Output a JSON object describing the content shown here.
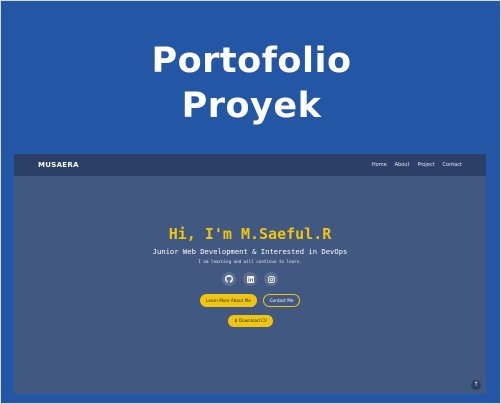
{
  "card": {
    "title_line1": "Portofolio",
    "title_line2": "Proyek"
  },
  "site": {
    "brand": "MUSAERA",
    "nav": [
      "Home",
      "About",
      "Project",
      "Contact"
    ],
    "hero": {
      "title": "Hi, I'm M.Saeful.R",
      "subtitle": "Junior Web Development & Interested in DevOps",
      "note": "I am learning and will continue to learn."
    },
    "socials": [
      "github-icon",
      "linkedin-icon",
      "instagram-icon"
    ],
    "buttons": {
      "learn_more": "Learn More About Me",
      "contact": "Contact Me",
      "download_cv": "Download CV"
    },
    "back_to_top_icon": "arrow-up-icon"
  },
  "colors": {
    "outer_bg": "#2456a6",
    "site_bg": "#415880",
    "navbar_bg": "#2c3f66",
    "accent": "#f1c40f"
  }
}
